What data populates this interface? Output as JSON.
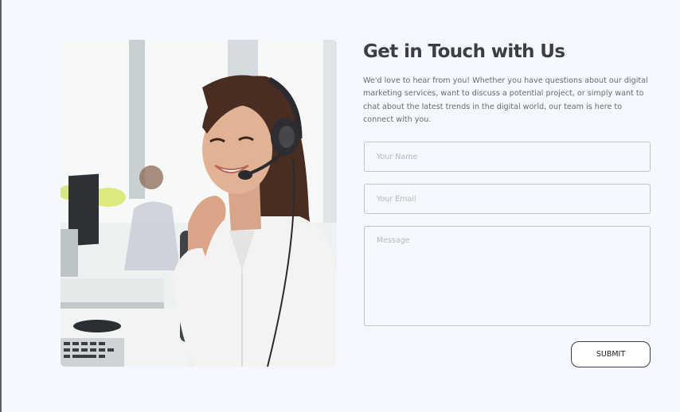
{
  "contact": {
    "title": "Get in Touch with Us",
    "intro": "We'd love to hear from you! Whether you have questions about our digital marketing services, want to discuss a potential project, or simply want to chat about the latest trends in the digital world, our team is here to connect with you.",
    "name_placeholder": "Your Name",
    "email_placeholder": "Your Email",
    "message_placeholder": "Message",
    "submit_label": "SUBMIT"
  },
  "colors": {
    "background": "#f5f8fe",
    "heading": "#3b3e44",
    "body_text": "#676c75",
    "field_border": "#bfc3ca"
  }
}
